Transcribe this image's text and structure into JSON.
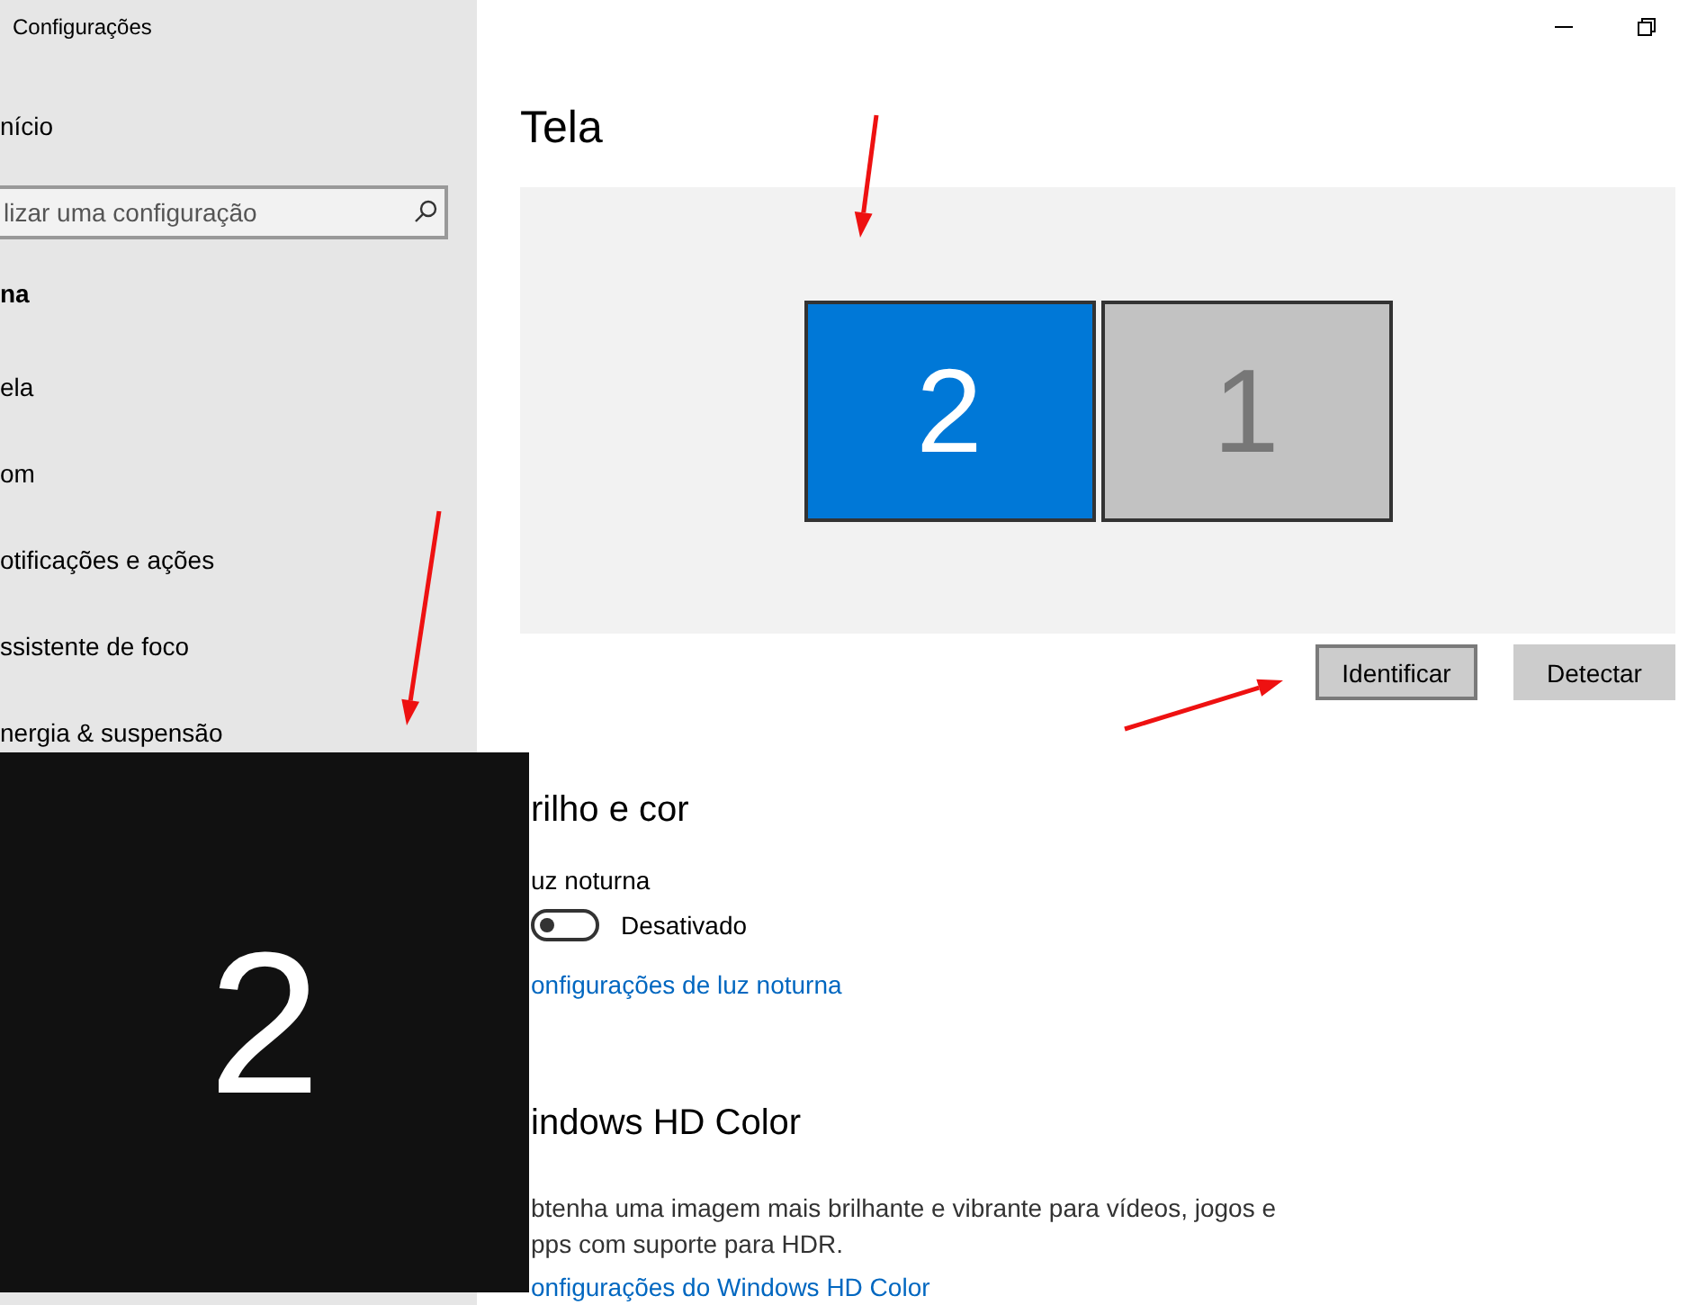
{
  "window": {
    "title": "Configurações"
  },
  "sidebar": {
    "home": "nício",
    "search": {
      "placeholder": "lizar uma configuração"
    },
    "section": "na",
    "items": [
      {
        "label": "ela"
      },
      {
        "label": "om"
      },
      {
        "label": "otificações e ações"
      },
      {
        "label": "ssistente de foco"
      },
      {
        "label": "nergia & suspensão"
      }
    ]
  },
  "main": {
    "title": "Tela",
    "monitors": [
      {
        "label": "2",
        "selected": true
      },
      {
        "label": "1",
        "selected": false
      }
    ],
    "buttons": [
      {
        "label": "Identificar",
        "focused": true
      },
      {
        "label": "Detectar",
        "focused": false
      }
    ],
    "brightness": {
      "heading": "rilho e cor",
      "night_light_label": "uz noturna",
      "toggle": {
        "on": false,
        "text": "Desativado"
      },
      "link": "onfigurações de luz noturna"
    },
    "hd_color": {
      "heading": "indows HD Color",
      "description": [
        "btenha uma imagem mais brilhante e vibrante para vídeos, jogos e",
        "pps com suporte para HDR."
      ],
      "link": "onfigurações do Windows HD Color"
    }
  },
  "identify_overlay": {
    "label": "2"
  }
}
